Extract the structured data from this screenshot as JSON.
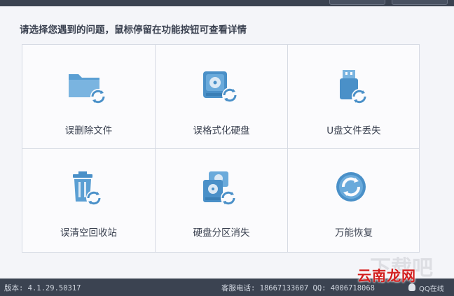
{
  "prompt": "请选择您遇到的问题，鼠标停留在功能按钮可查看详情",
  "tiles": [
    {
      "label": "误删除文件",
      "icon": "folder-recover-icon"
    },
    {
      "label": "误格式化硬盘",
      "icon": "harddisk-recover-icon"
    },
    {
      "label": "U盘文件丢失",
      "icon": "usb-drive-recover-icon"
    },
    {
      "label": "误清空回收站",
      "icon": "recycle-bin-recover-icon"
    },
    {
      "label": "硬盘分区消失",
      "icon": "partition-recover-icon"
    },
    {
      "label": "万能恢复",
      "icon": "universal-recover-icon"
    }
  ],
  "footer": {
    "version": "版本: 4.1.29.50317",
    "service": "客服电话: 18667133607 QQ: 4006718068",
    "qq_status": "QQ在线"
  },
  "watermark": "云南龙网",
  "colors": {
    "accent": "#4a90c8",
    "text": "#3a4150",
    "footer": "#3b4351"
  }
}
